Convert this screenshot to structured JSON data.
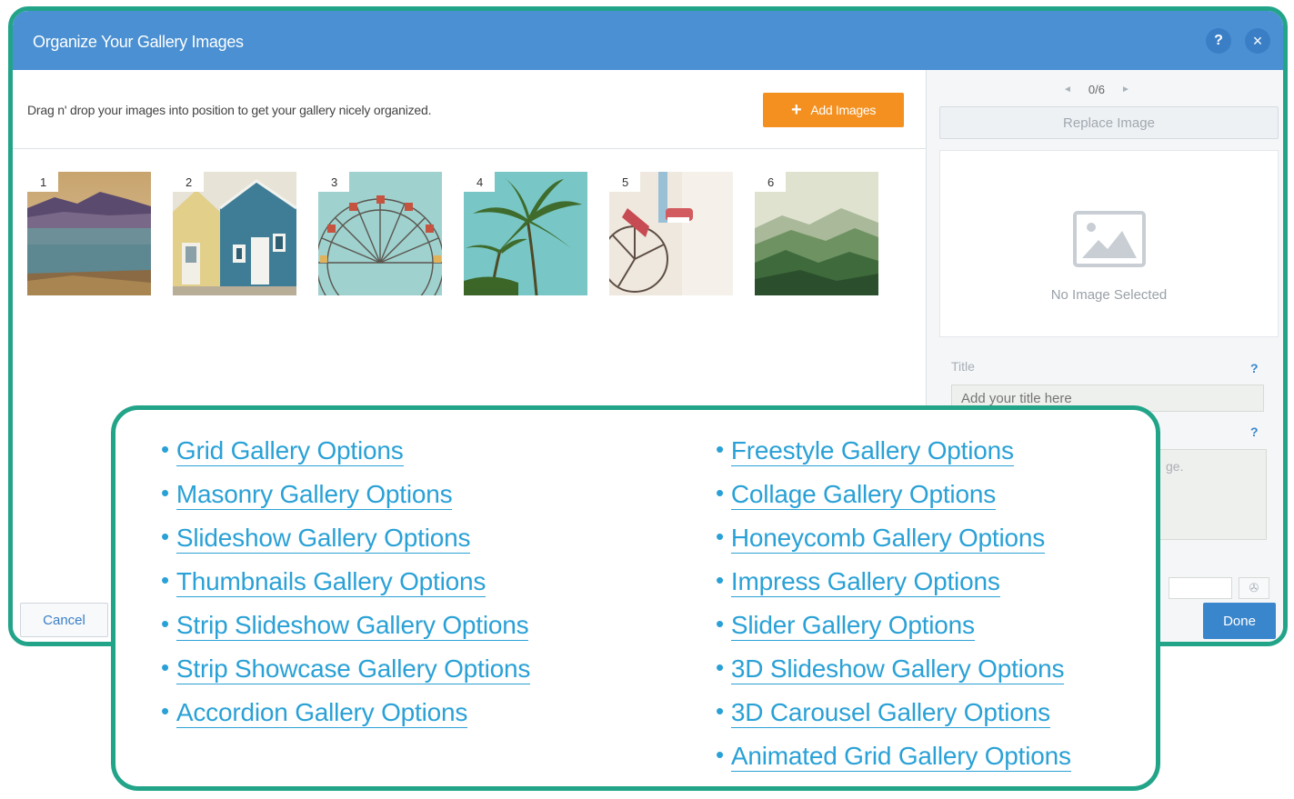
{
  "dialog": {
    "title": "Organize Your Gallery Images",
    "help_label": "?",
    "close_label": "×",
    "instruction": "Drag n' drop your images into position to get your gallery nicely organized.",
    "add_images_label": "Add Images",
    "add_icon": "+",
    "cancel_label": "Cancel",
    "done_label": "Done",
    "thumbnails": [
      {
        "number": "1",
        "subject": "lake-mountains"
      },
      {
        "number": "2",
        "subject": "beach-houses"
      },
      {
        "number": "3",
        "subject": "ferris-wheel"
      },
      {
        "number": "4",
        "subject": "palm-trees"
      },
      {
        "number": "5",
        "subject": "bicycle"
      },
      {
        "number": "6",
        "subject": "green-mountains"
      }
    ]
  },
  "sidebar": {
    "pager": {
      "text": "0/6",
      "prev": "◄",
      "next": "►"
    },
    "replace_label": "Replace Image",
    "no_image_text": "No Image Selected",
    "title_label": "Title",
    "title_placeholder": "Add your title here",
    "help_mark": "?",
    "description_partial": "ge.",
    "link_icon": "✇"
  },
  "options": {
    "left": [
      "Grid Gallery Options",
      "Masonry Gallery Options",
      "Slideshow Gallery Options",
      "Thumbnails Gallery Options",
      "Strip Slideshow Gallery Options",
      "Strip Showcase Gallery Options",
      "Accordion Gallery Options"
    ],
    "right": [
      "Freestyle Gallery Options",
      "Collage Gallery Options",
      "Honeycomb Gallery Options",
      "Impress Gallery Options",
      "Slider Gallery Options",
      "3D Slideshow Gallery Options",
      "3D Carousel Gallery Options",
      "Animated Grid Gallery Options"
    ],
    "bullet": "•"
  },
  "colors": {
    "accent_teal": "#22a489",
    "title_bar": "#4a90d2",
    "add_button": "#f3901f",
    "link_blue": "#2aa1d6",
    "done_button": "#3a86cc"
  }
}
